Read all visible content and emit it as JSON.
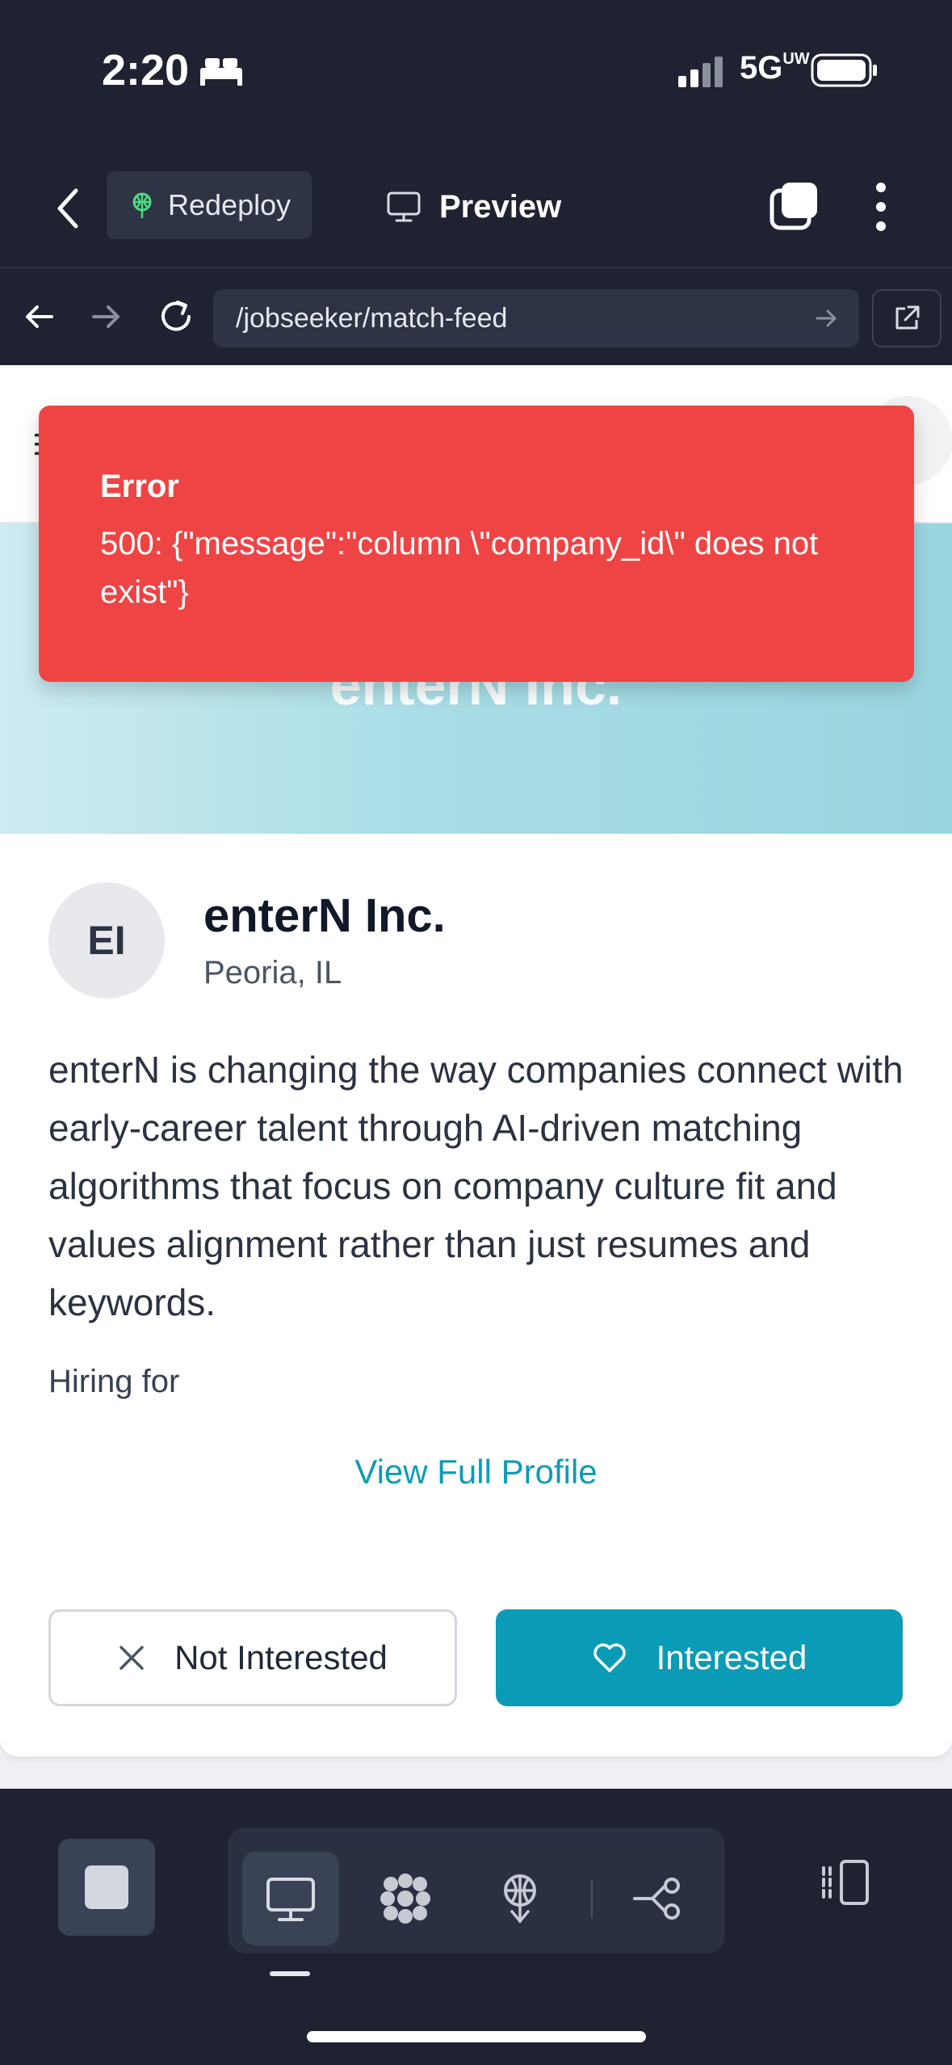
{
  "status_bar": {
    "time": "2:20",
    "network": "5G",
    "network_super": "UW"
  },
  "toolbar": {
    "redeploy_label": "Redeploy",
    "preview_label": "Preview"
  },
  "browser": {
    "url": "/jobseeker/match-feed"
  },
  "card": {
    "banner_title": "enterN Inc.",
    "logo_initials": "EI",
    "company_name": "enterN Inc.",
    "location": "Peoria, IL",
    "description": "enterN is changing the way companies connect with early-career talent through AI-driven matching algorithms that focus on company culture fit and values alignment rather than just resumes and keywords.",
    "hiring_for": "Hiring for",
    "view_profile": "View Full Profile",
    "not_interested": "Not Interested",
    "interested": "Interested"
  },
  "toast": {
    "title": "Error",
    "message": "500: {\"message\":\"column \\\"company_id\\\" does not exist\"}"
  },
  "colors": {
    "accent": "#0a9bb6",
    "error": "#ef4444",
    "chrome": "#1e2231"
  }
}
